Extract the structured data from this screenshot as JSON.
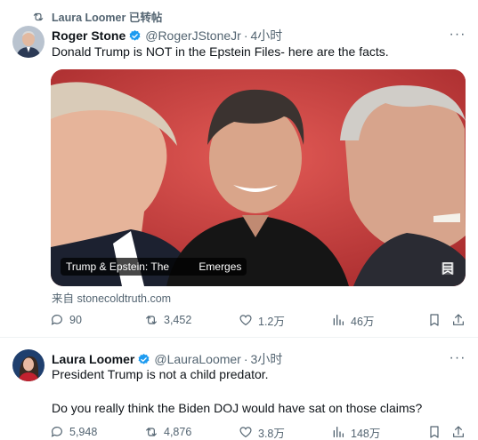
{
  "tweet1": {
    "retweet_label": "Laura Loomer 已转帖",
    "author_name": "Roger Stone",
    "author_handle": "@RogerJStoneJr",
    "time": "4小时",
    "text": "Donald Trump is NOT in the Epstein Files- here are the facts.",
    "card_title": "Trump & Epstein: The          Emerges",
    "card_source": "来自 stonecoldtruth.com",
    "replies": "90",
    "retweets": "3,452",
    "likes": "1.2万",
    "views": "46万"
  },
  "tweet2": {
    "author_name": "Laura Loomer",
    "author_handle": "@LauraLoomer",
    "time": "3小时",
    "text": "President Trump is not a child predator.\n\nDo you really think the Biden DOJ would have sat on those claims?",
    "replies": "5,948",
    "retweets": "4,876",
    "likes": "3.8万",
    "views": "148万"
  },
  "colors": {
    "text": "#0f1419",
    "secondary": "#536471",
    "verified": "#1d9bf0",
    "card_bg": "#c73a3a"
  },
  "icons": [
    "retweet-icon",
    "verified-badge-icon",
    "more-icon",
    "reply-icon",
    "like-icon",
    "views-icon",
    "bookmark-icon",
    "share-icon"
  ]
}
